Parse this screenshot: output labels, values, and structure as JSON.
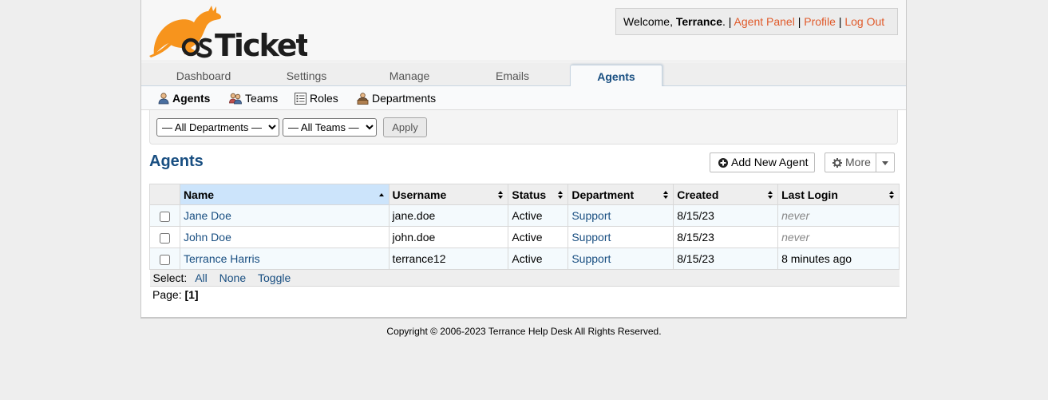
{
  "header": {
    "logo_text": "osTicket",
    "welcome_prefix": "Welcome, ",
    "user_name": "Terrance",
    "welcome_suffix": ". |",
    "agent_panel": "Agent Panel",
    "profile": "Profile",
    "log_out": "Log Out",
    "link_color": "#e05a2a"
  },
  "nav": {
    "tabs": [
      {
        "label": "Dashboard"
      },
      {
        "label": "Settings"
      },
      {
        "label": "Manage"
      },
      {
        "label": "Emails"
      },
      {
        "label": "Agents",
        "active": true
      }
    ]
  },
  "subnav": {
    "items": [
      {
        "label": "Agents",
        "icon": "agent-icon",
        "active": true
      },
      {
        "label": "Teams",
        "icon": "teams-icon"
      },
      {
        "label": "Roles",
        "icon": "roles-icon"
      },
      {
        "label": "Departments",
        "icon": "departments-icon"
      }
    ]
  },
  "filters": {
    "department_selected": "— All Departments —",
    "team_selected": "— All Teams —",
    "apply_label": "Apply"
  },
  "page": {
    "title": "Agents",
    "add_label": "Add New Agent",
    "more_label": "More",
    "title_color": "#184e81"
  },
  "table": {
    "columns": [
      "Name",
      "Username",
      "Status",
      "Department",
      "Created",
      "Last Login"
    ],
    "sorted_column": "Name",
    "rows": [
      {
        "name": "Jane Doe",
        "username": "jane.doe",
        "status": "Active",
        "department": "Support",
        "created": "8/15/23",
        "last_login": "never"
      },
      {
        "name": "John Doe",
        "username": "john.doe",
        "status": "Active",
        "department": "Support",
        "created": "8/15/23",
        "last_login": "never"
      },
      {
        "name": "Terrance Harris",
        "username": "terrance12",
        "status": "Active",
        "department": "Support",
        "created": "8/15/23",
        "last_login": "8 minutes ago"
      }
    ],
    "select_label": "Select:",
    "select_all": "All",
    "select_none": "None",
    "select_toggle": "Toggle"
  },
  "pager": {
    "label": "Page:",
    "current": "[1]"
  },
  "footer": {
    "copyright": "Copyright © 2006-2023 Terrance Help Desk All Rights Reserved."
  }
}
